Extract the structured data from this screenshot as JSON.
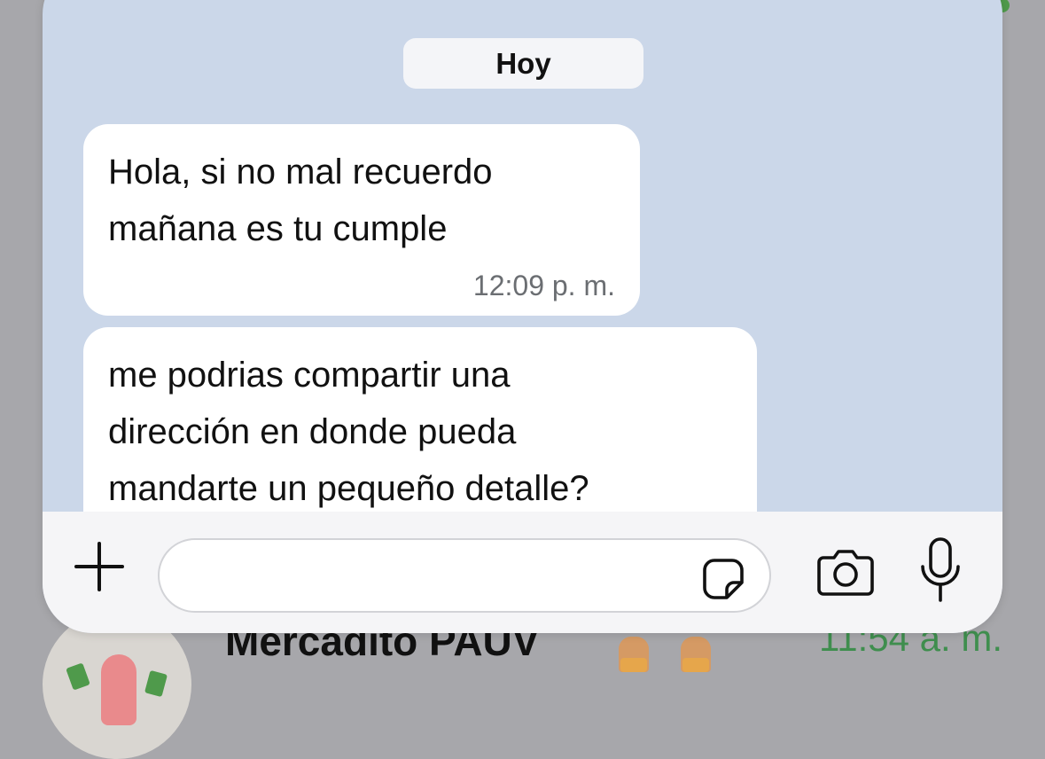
{
  "background_chat": {
    "name": "Mercadito PAUV",
    "time": "11:54 a. m.",
    "avatar_icon": "patrick-star-avatar"
  },
  "chat": {
    "date_label": "Hoy",
    "messages": [
      {
        "text": "Hola, si no mal recuerdo\nmañana es tu cumple",
        "time": "12:09 p. m.",
        "direction": "incoming"
      },
      {
        "text": "me podrias compartir una\ndirección en donde pueda\nmandarte un pequeño detalle?",
        "time": "",
        "direction": "incoming"
      }
    ]
  },
  "input_bar": {
    "message_value": "",
    "placeholder": "",
    "icons": {
      "add": "plus-icon",
      "sticker": "sticker-icon",
      "camera": "camera-icon",
      "microphone": "microphone-icon"
    }
  },
  "colors": {
    "chat_background": "#cbd7e9",
    "bubble": "#ffffff",
    "timestamp": "#6b6e72",
    "input_bar": "#f5f5f7",
    "background_time_green": "#3f8e4e"
  }
}
